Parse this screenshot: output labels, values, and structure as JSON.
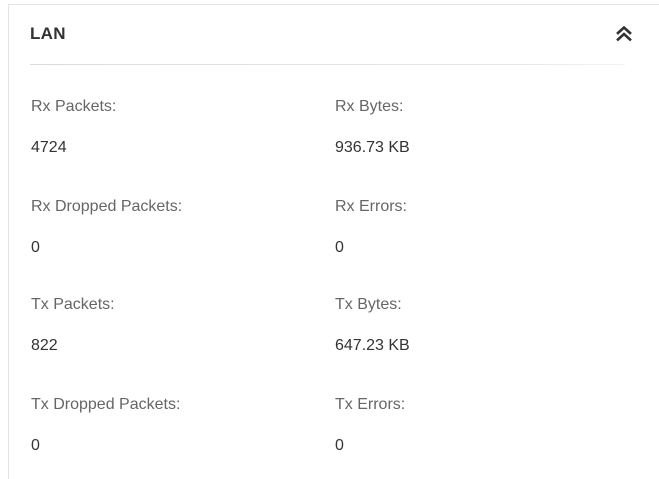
{
  "section": {
    "title": "LAN"
  },
  "stats": {
    "rx_packets": {
      "label": "Rx Packets:",
      "value": "4724"
    },
    "rx_bytes": {
      "label": "Rx Bytes:",
      "value": "936.73 KB"
    },
    "rx_dropped_packets": {
      "label": "Rx Dropped Packets:",
      "value": "0"
    },
    "rx_errors": {
      "label": "Rx Errors:",
      "value": "0"
    },
    "tx_packets": {
      "label": "Tx Packets:",
      "value": "822"
    },
    "tx_bytes": {
      "label": "Tx Bytes:",
      "value": "647.23 KB"
    },
    "tx_dropped_packets": {
      "label": "Tx Dropped Packets:",
      "value": "0"
    },
    "tx_errors": {
      "label": "Tx Errors:",
      "value": "0"
    }
  },
  "icons": {
    "collapse": "double-chevron-up-icon"
  },
  "colors": {
    "title": "#333333",
    "label": "#666666",
    "value": "#333333",
    "divider": "#dcdcdc"
  }
}
